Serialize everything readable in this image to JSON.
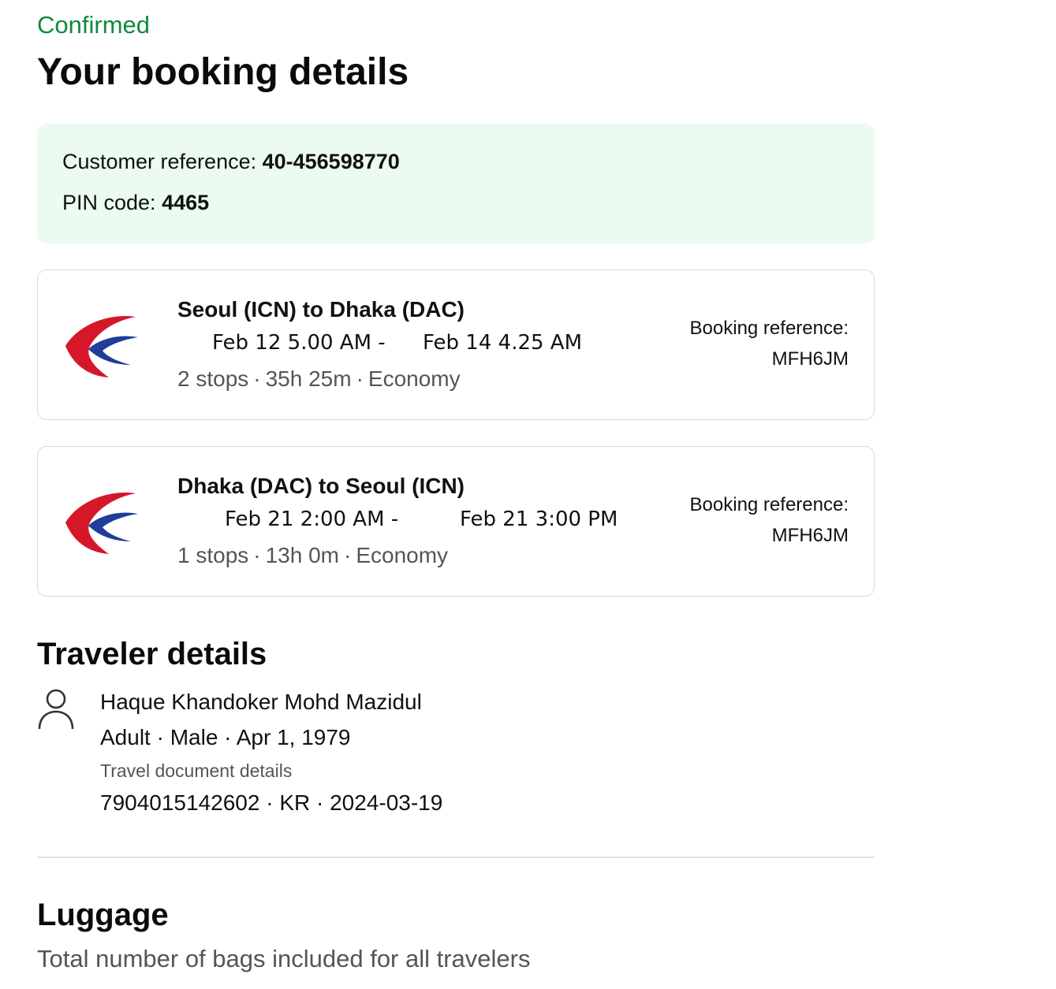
{
  "header": {
    "status": "Confirmed",
    "title": "Your booking details"
  },
  "reference": {
    "customer_label": "Customer reference: ",
    "customer_value": "40-456598770",
    "pin_label": "PIN code: ",
    "pin_value": "4465"
  },
  "flights": [
    {
      "route": "Seoul (ICN) to Dhaka (DAC)",
      "depart": "Feb 12 5.00 AM -",
      "arrive": "Feb 14 4.25 AM",
      "stops": "2 stops",
      "duration": "35h 25m",
      "cabin": "Economy",
      "booking_label": "Booking reference:",
      "booking_ref": "MFH6JM",
      "logo": "china-eastern-logo"
    },
    {
      "route": "Dhaka (DAC) to Seoul (ICN)",
      "depart": "Feb 21 2:00 AM -",
      "arrive": "Feb 21 3:00 PM",
      "stops": "1 stops",
      "duration": "13h 0m",
      "cabin": "Economy",
      "booking_label": "Booking reference:",
      "booking_ref": "MFH6JM",
      "logo": "china-eastern-logo"
    }
  ],
  "traveler": {
    "section_title": "Traveler details",
    "icon": "person-icon",
    "name": "Haque Khandoker Mohd Mazidul",
    "info": "Adult · Male · Apr 1, 1979",
    "doc_label": "Travel document details",
    "doc_value": "7904015142602 · KR · 2024-03-19"
  },
  "luggage": {
    "section_title": "Luggage",
    "subtitle": "Total number of bags included for all travelers"
  },
  "colors": {
    "status_green": "#118a3b",
    "ref_box_bg": "#ebfbef",
    "logo_red": "#d6172a",
    "logo_blue": "#1f3d9a"
  }
}
